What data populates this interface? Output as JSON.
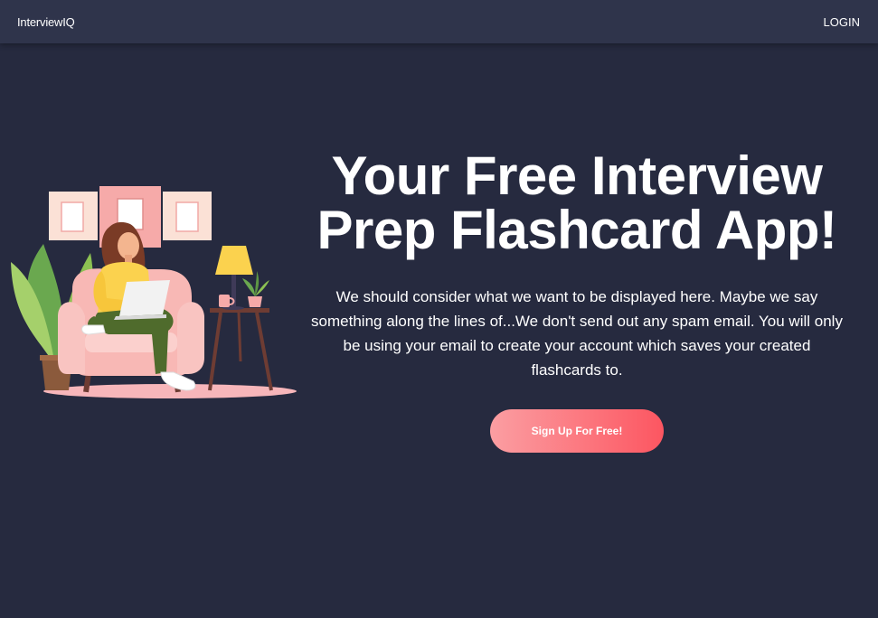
{
  "nav": {
    "brand": "InterviewIQ",
    "login_label": "LOGIN"
  },
  "hero": {
    "headline": "Your Free Interview Prep Flashcard App!",
    "description": "We should consider what we want to be displayed here. Maybe we say something along the lines of...We don't send out any spam email. You will only be using your email to create your account which saves your created flashcards to.",
    "cta_label": "Sign Up For Free!"
  },
  "colors": {
    "background": "#262a3f",
    "navbar": "#2f344b",
    "cta_gradient_start": "#fb9ea2",
    "cta_gradient_end": "#fc5661"
  },
  "illustration": {
    "icon": "woman-with-laptop-on-armchair-illustration"
  }
}
